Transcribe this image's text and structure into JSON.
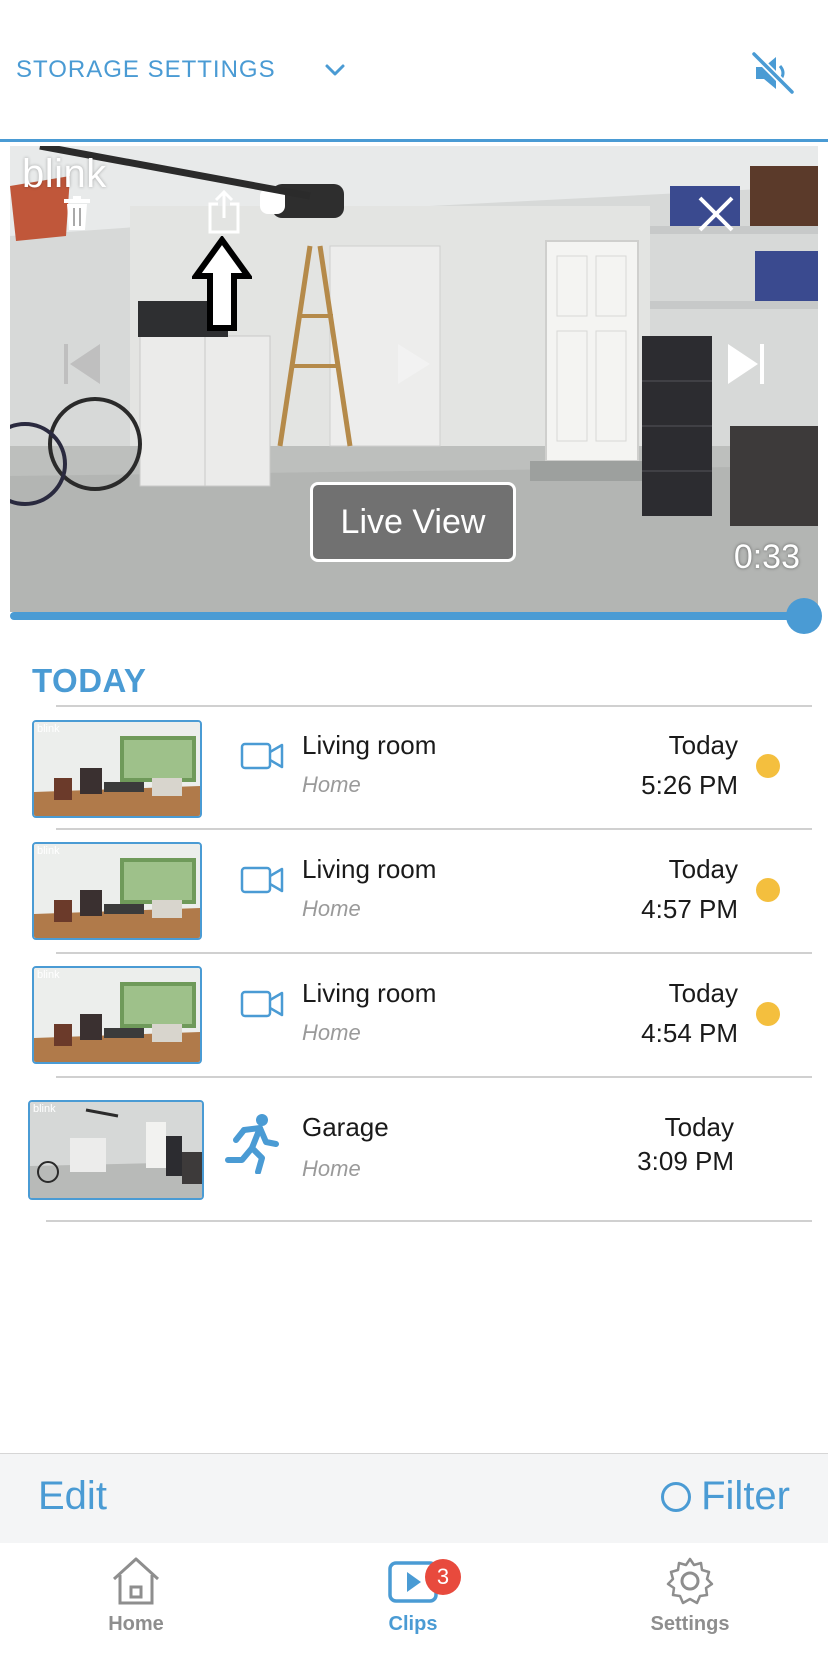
{
  "header": {
    "storage_label": "STORAGE SETTINGS",
    "mute_icon": "speaker-muted-icon"
  },
  "player": {
    "brand": "blink",
    "live_view_label": "Live View",
    "time": "0:33",
    "progress": 1.0
  },
  "clips": {
    "section_title": "TODAY",
    "items": [
      {
        "camera": "Living room",
        "location": "Home",
        "day": "Today",
        "time": "5:26 PM",
        "type": "video",
        "unread": true
      },
      {
        "camera": "Living room",
        "location": "Home",
        "day": "Today",
        "time": "4:57 PM",
        "type": "video",
        "unread": true
      },
      {
        "camera": "Living room",
        "location": "Home",
        "day": "Today",
        "time": "4:54 PM",
        "type": "video",
        "unread": true
      },
      {
        "camera": "Garage",
        "location": "Home",
        "day": "Today",
        "time": "3:09 PM",
        "type": "motion",
        "unread": false
      }
    ],
    "thumb_brand": "blink"
  },
  "actions": {
    "edit_label": "Edit",
    "filter_label": "Filter"
  },
  "tabs": {
    "home": "Home",
    "clips": "Clips",
    "clips_badge": "3",
    "settings": "Settings"
  },
  "colors": {
    "accent": "#4a9bd4",
    "unread_dot": "#f4bf3e",
    "badge": "#e84a3d"
  }
}
